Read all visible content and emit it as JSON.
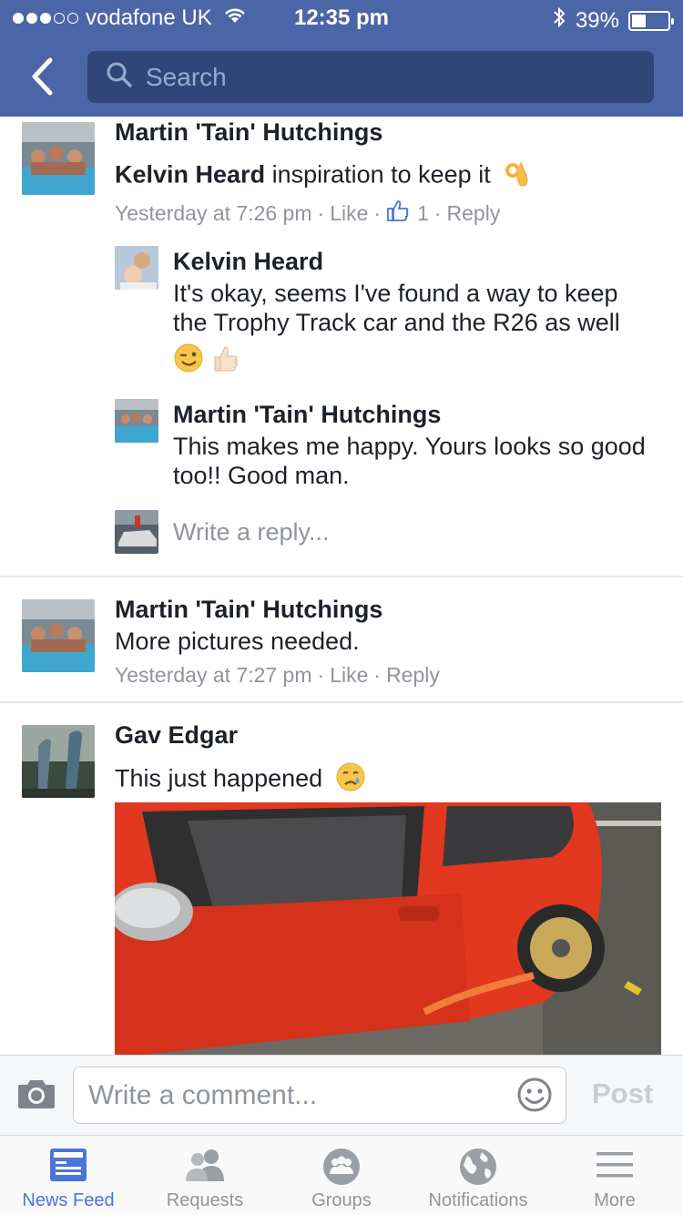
{
  "status_bar": {
    "carrier": "vodafone UK",
    "time": "12:35 pm",
    "battery": "39%",
    "battery_level": 0.39
  },
  "search": {
    "placeholder": "Search"
  },
  "comments": [
    {
      "name": "Martin 'Tain' Hutchings",
      "mention": "Kelvin Heard",
      "text": " inspiration to keep it",
      "emoji": "ok-hand",
      "time": "Yesterday at 7:26 pm",
      "like": "Like",
      "like_count": "1",
      "reply": "Reply"
    },
    {
      "name": "Martin 'Tain' Hutchings",
      "text": "More pictures needed.",
      "time": "Yesterday at 7:27 pm",
      "like": "Like",
      "reply": "Reply"
    },
    {
      "name": "Gav Edgar",
      "text": "This just happened",
      "emoji": "crying-face"
    }
  ],
  "replies": [
    {
      "name": "Kelvin Heard",
      "text": "It's okay, seems I've found a way to keep the Trophy Track car and the R26 as well",
      "emojis": [
        "winking-face",
        "thumbs-up"
      ]
    },
    {
      "name": "Martin 'Tain' Hutchings",
      "text": "This makes me happy. Yours looks so good too!! Good man."
    }
  ],
  "reply_placeholder": "Write a reply...",
  "comment_bar": {
    "placeholder": "Write a comment...",
    "post_label": "Post"
  },
  "tabs": [
    {
      "label": "News Feed",
      "icon": "news-feed-icon",
      "active": true
    },
    {
      "label": "Requests",
      "icon": "requests-icon",
      "active": false
    },
    {
      "label": "Groups",
      "icon": "groups-icon",
      "active": false
    },
    {
      "label": "Notifications",
      "icon": "globe-icon",
      "active": false
    },
    {
      "label": "More",
      "icon": "menu-icon",
      "active": false
    }
  ],
  "colors": {
    "header": "#4a66a6",
    "search_bg": "#2e4678",
    "link_active": "#4a76d8",
    "meta_gray": "#90949c"
  }
}
